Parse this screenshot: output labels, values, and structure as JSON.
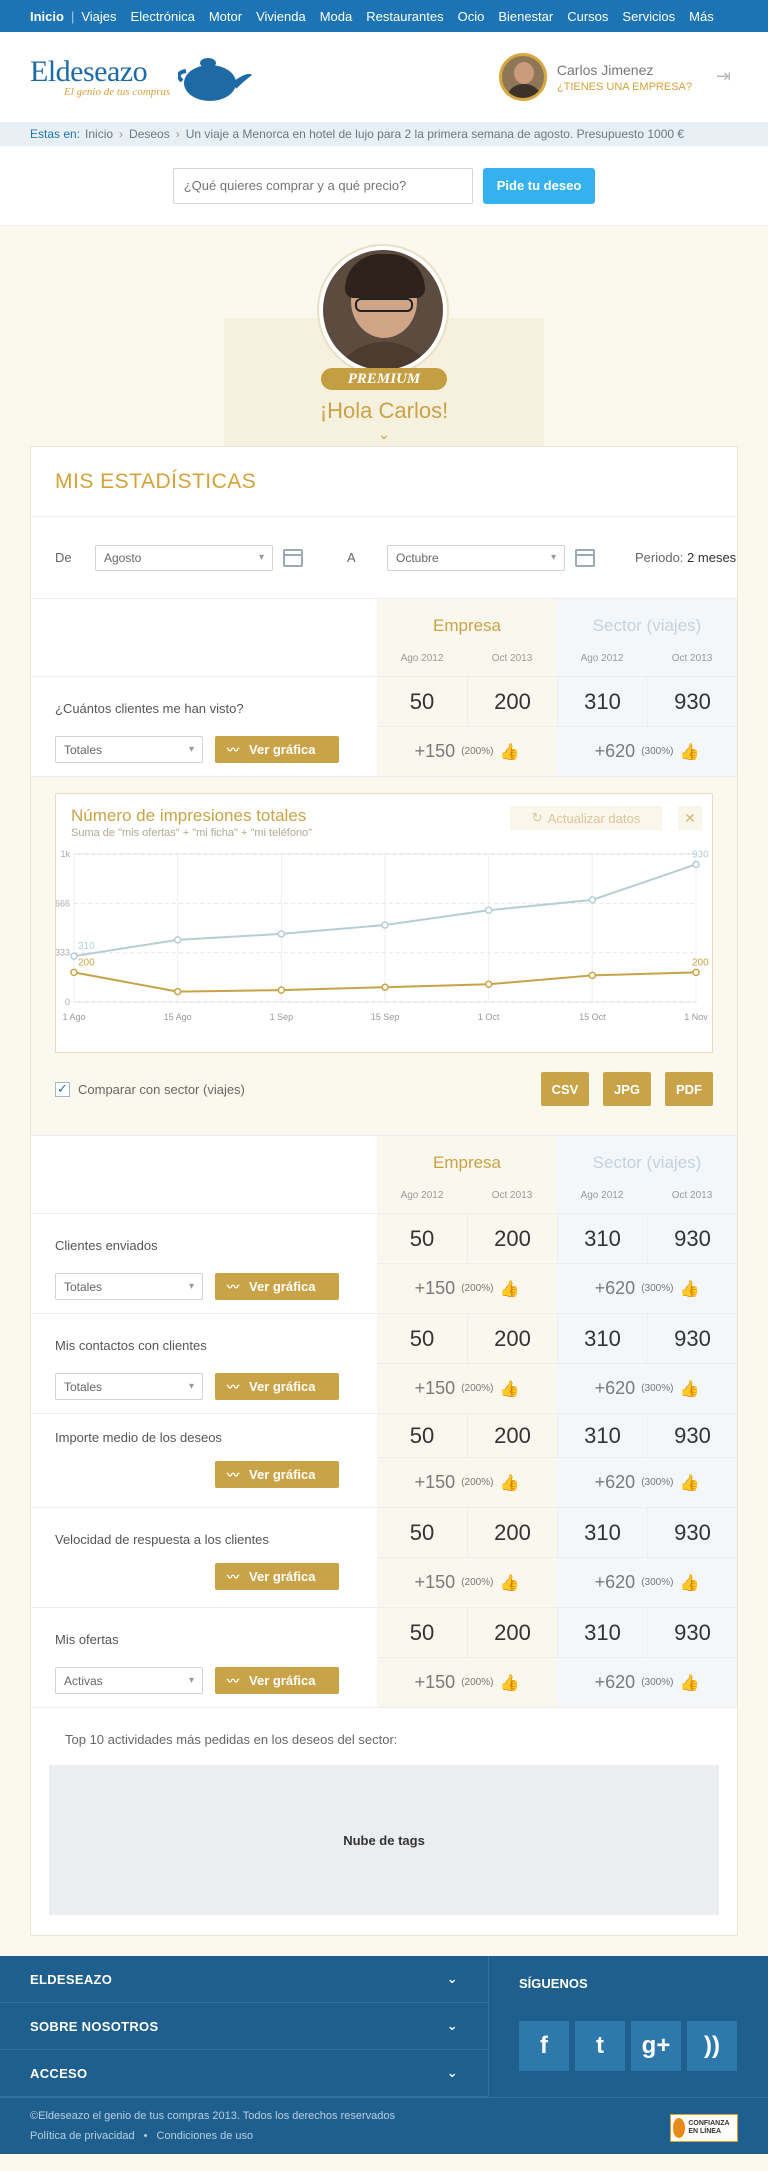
{
  "nav": [
    "Inicio",
    "Viajes",
    "Electrónica",
    "Motor",
    "Vivienda",
    "Moda",
    "Restaurantes",
    "Ocio",
    "Bienestar",
    "Cursos",
    "Servicios",
    "Más"
  ],
  "header": {
    "logo_name": "Eldeseazo",
    "logo_tagline": "El genio de tus compras",
    "user_name": "Carlos Jimenez",
    "user_company": "¿TIENES UNA EMPRESA?"
  },
  "breadcrumb": {
    "label": "Estas en:",
    "items": [
      "Inicio",
      "Deseos",
      "Un viaje a Menorca en hotel de lujo para 2 la primera semana de agosto. Presupuesto 1000 €"
    ]
  },
  "search": {
    "placeholder": "¿Qué quieres comprar y a qué precio?",
    "button": "Pide tu deseo"
  },
  "profile": {
    "badge": "PREMIUM",
    "greeting": "¡Hola Carlos!"
  },
  "stats": {
    "title": "MIS ESTADÍSTICAS",
    "from_label": "De",
    "from_value": "Agosto",
    "to_label": "A",
    "to_value": "Octubre",
    "period_label": "Periodo:",
    "period_value": "2 meses",
    "col_empresa": "Empresa",
    "col_sector": "Sector (viajes)",
    "dates": [
      "Ago 2012",
      "Oct 2013",
      "Ago 2012",
      "Oct 2013"
    ],
    "ver_grafica": "Ver gráfica",
    "rows": [
      {
        "label": "¿Cuántos clientes me han visto?",
        "select": "Totales",
        "vals": [
          "50",
          "200",
          "310",
          "930"
        ],
        "emp_diff": "+150",
        "emp_pct": "(200%)",
        "sec_diff": "+620",
        "sec_pct": "(300%)"
      },
      {
        "label": "Clientes enviados",
        "select": "Totales",
        "vals": [
          "50",
          "200",
          "310",
          "930"
        ],
        "emp_diff": "+150",
        "emp_pct": "(200%)",
        "sec_diff": "+620",
        "sec_pct": "(300%)"
      },
      {
        "label": "Mis contactos con clientes",
        "select": "Totales",
        "vals": [
          "50",
          "200",
          "310",
          "930"
        ],
        "emp_diff": "+150",
        "emp_pct": "(200%)",
        "sec_diff": "+620",
        "sec_pct": "(300%)"
      },
      {
        "label": "Importe medio de los deseos",
        "select": "",
        "vals": [
          "50",
          "200",
          "310",
          "930"
        ],
        "emp_diff": "+150",
        "emp_pct": "(200%)",
        "sec_diff": "+620",
        "sec_pct": "(300%)"
      },
      {
        "label": "Velocidad de respuesta a los clientes",
        "select": "",
        "vals": [
          "50",
          "200",
          "310",
          "930"
        ],
        "emp_diff": "+150",
        "emp_pct": "(200%)",
        "sec_diff": "+620",
        "sec_pct": "(300%)"
      },
      {
        "label": "Mis ofertas",
        "select": "Activas",
        "vals": [
          "50",
          "200",
          "310",
          "930"
        ],
        "emp_diff": "+150",
        "emp_pct": "(200%)",
        "sec_diff": "+620",
        "sec_pct": "(300%)"
      }
    ]
  },
  "chart_panel": {
    "title": "Número de impresiones totales",
    "subtitle": "Suma de \"mis ofertas\" + \"mi ficha\" + \"mi teléfono\"",
    "refresh": "Actualizar datos",
    "compare_label": "Comparar con sector (viajes)",
    "downloads": [
      "CSV",
      "JPG",
      "PDF"
    ]
  },
  "chart_data": {
    "type": "line",
    "x": [
      "1 Ago",
      "15 Ago",
      "1 Sep",
      "15 Sep",
      "1 Oct",
      "15 Oct",
      "1 Nov"
    ],
    "yticks": [
      "1k",
      "666",
      "333",
      "0"
    ],
    "ylim": [
      0,
      1000
    ],
    "series": [
      {
        "values": [
          310,
          420,
          460,
          520,
          620,
          690,
          930
        ],
        "color": "#b7cdd6",
        "first_label": "310",
        "last_label": "930"
      },
      {
        "values": [
          200,
          70,
          80,
          100,
          120,
          180,
          200
        ],
        "color": "#c9a347",
        "first_label": "200",
        "last_label": "200"
      }
    ]
  },
  "tags": {
    "title": "Top 10 actividades más pedidas en los deseos del sector:",
    "box": "Nube de tags"
  },
  "footer": {
    "items": [
      "ELDESEAZO",
      "SOBRE NOSOTROS",
      "ACCESO"
    ],
    "siguenos": "SÍGUENOS",
    "copyright": "©Eldeseazo el genio de tus compras 2013. Todos los derechos reservados",
    "links": [
      "Política de privacidad",
      "Condiciones de uso"
    ],
    "badge": "CONFIANZA EN LÍNEA"
  }
}
